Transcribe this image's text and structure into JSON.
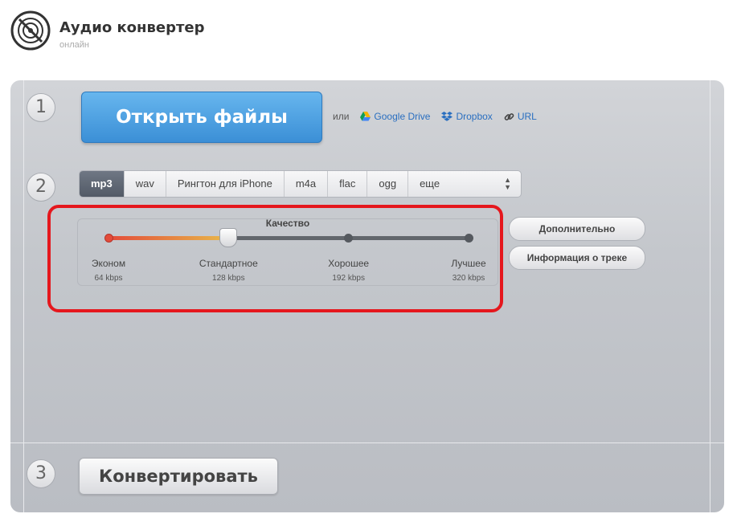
{
  "header": {
    "title": "Аудио конвертер",
    "subtitle": "онлайн"
  },
  "steps": [
    "1",
    "2",
    "3"
  ],
  "step1": {
    "open_label": "Открыть файлы",
    "or_label": "или",
    "sources": [
      {
        "label": "Google Drive",
        "icon": "google-drive-icon"
      },
      {
        "label": "Dropbox",
        "icon": "dropbox-icon"
      },
      {
        "label": "URL",
        "icon": "link-icon"
      }
    ]
  },
  "step2": {
    "formats": [
      "mp3",
      "wav",
      "Рингтон для iPhone",
      "m4a",
      "flac",
      "ogg"
    ],
    "active_format": "mp3",
    "more_label": "еще",
    "quality": {
      "title": "Качество",
      "selected_index": 1,
      "levels": [
        {
          "name": "Эконом",
          "bitrate": "64 kbps"
        },
        {
          "name": "Стандартное",
          "bitrate": "128 kbps"
        },
        {
          "name": "Хорошее",
          "bitrate": "192 kbps"
        },
        {
          "name": "Лучшее",
          "bitrate": "320 kbps"
        }
      ]
    },
    "advanced_label": "Дополнительно",
    "track_info_label": "Информация о треке"
  },
  "step3": {
    "convert_label": "Конвертировать"
  },
  "colors": {
    "accent": "#3b8fd6",
    "highlight": "#e5171d",
    "link": "#2a6fc0"
  }
}
